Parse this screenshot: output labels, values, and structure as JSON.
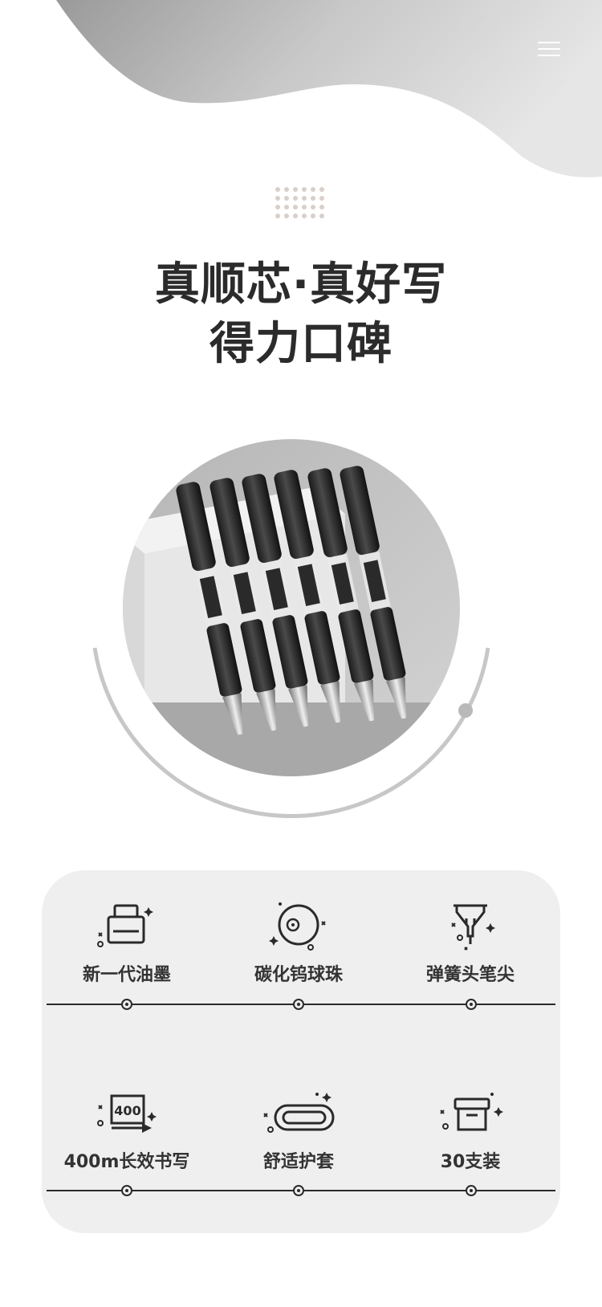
{
  "header": {
    "menu_icon": "hamburger-menu-icon"
  },
  "headline": {
    "line1": "真顺芯·真好写",
    "line2": "得力口碑"
  },
  "features": [
    {
      "label": "新一代油墨",
      "icon": "ink-bottle-icon"
    },
    {
      "label": "碳化钨球珠",
      "icon": "tungsten-ball-icon"
    },
    {
      "label": "弹簧头笔尖",
      "icon": "spring-nib-icon"
    },
    {
      "label": "400m长效书写",
      "icon": "400m-length-icon"
    },
    {
      "label": "舒适护套",
      "icon": "grip-sleeve-icon"
    },
    {
      "label": "30支装",
      "icon": "box-package-icon"
    }
  ],
  "colors": {
    "background": "#ffffff",
    "wave_gray": "#bdbdbd",
    "panel": "#efefef",
    "text_dark": "#2b2b2b"
  }
}
